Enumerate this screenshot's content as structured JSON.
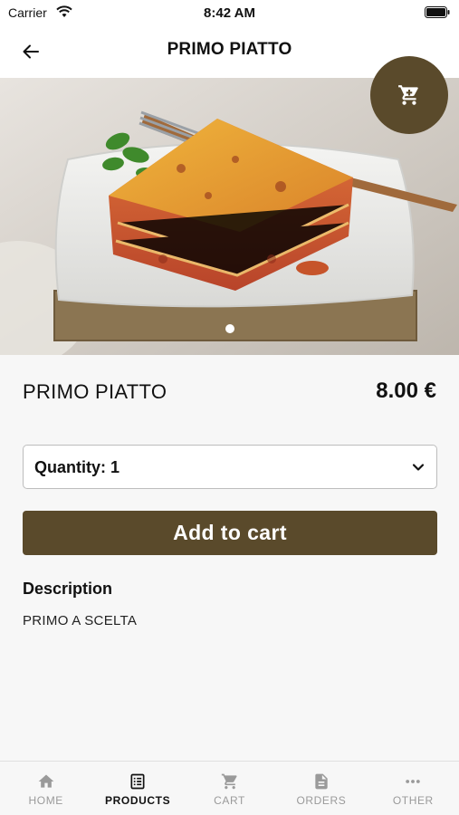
{
  "status_bar": {
    "carrier": "Carrier",
    "time": "8:42 AM"
  },
  "header": {
    "title": "PRIMO PIATTO"
  },
  "product": {
    "name": "PRIMO PIATTO",
    "price": "8.00 €",
    "quantity_label": "Quantity: 1",
    "add_to_cart_label": "Add to cart",
    "description_heading": "Description",
    "description": "PRIMO A SCELTA"
  },
  "tabs": [
    {
      "label": "HOME",
      "icon": "home-icon"
    },
    {
      "label": "PRODUCTS",
      "icon": "list-icon",
      "active": true
    },
    {
      "label": "CART",
      "icon": "cart-icon"
    },
    {
      "label": "ORDERS",
      "icon": "document-icon"
    },
    {
      "label": "OTHER",
      "icon": "more-icon"
    }
  ],
  "colors": {
    "accent": "#5a4a2b",
    "inactive_tab": "#9a9a9a"
  }
}
